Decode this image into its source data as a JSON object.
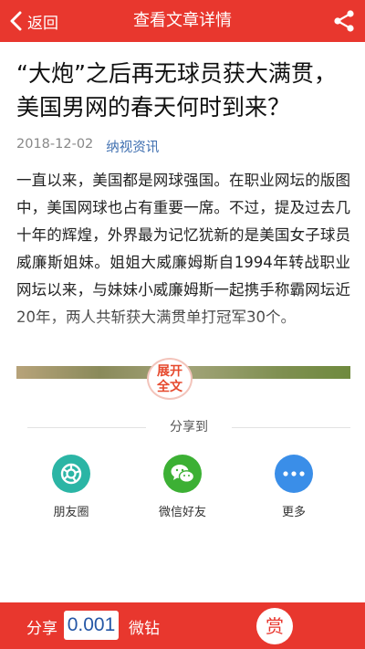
{
  "header": {
    "back_label": "返回",
    "title": "查看文章详情"
  },
  "article": {
    "title": "“大炮”之后再无球员获大满贯，美国男网的春天何时到来？",
    "date": "2018-12-02",
    "source": "纳视资讯",
    "body": "一直以来，美国都是网球强国。在职业网坛的版图中，美国网球也占有重要一席。不过，提及过去几十年的辉煌，外界最为记忆犹新的是美国女子球员威廉斯姐妹。姐姐大威廉姆斯自1994年转战职业网坛以来，与妹妹小威廉姆斯一起携手称霸网坛近20年，两人共斩获大满贯单打冠军30个。",
    "expand_line1": "展开",
    "expand_line2": "全文"
  },
  "share": {
    "heading": "分享到",
    "items": [
      {
        "label": "朋友圈",
        "icon": "moments-icon",
        "color": "#2bb5a5"
      },
      {
        "label": "微信好友",
        "icon": "wechat-icon",
        "color": "#3cb034"
      },
      {
        "label": "更多",
        "icon": "more-icon",
        "color": "#3a8ee8"
      }
    ]
  },
  "footer": {
    "share_label": "分享",
    "amount": "0.001",
    "unit": "微钻",
    "reward_label": "赏"
  },
  "colors": {
    "brand_red": "#e8372e",
    "link_blue": "#3f6fb0"
  }
}
